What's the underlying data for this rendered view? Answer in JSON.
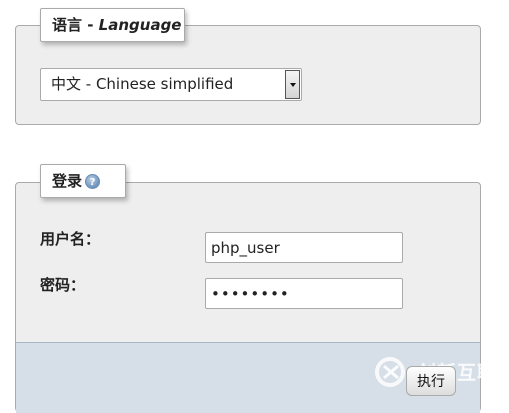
{
  "language": {
    "legend_cn": "语言 - ",
    "legend_en": "Language",
    "selected": "中文 - Chinese simplified"
  },
  "login": {
    "legend": "登录",
    "help_icon": "help-icon",
    "username_label": "用户名：",
    "username_value": "php_user",
    "password_label": "密码：",
    "password_value": "••••••••",
    "submit_label": "执行"
  },
  "watermark": {
    "text": "创新互联"
  },
  "colors": {
    "fieldset_bg": "#eeeeee",
    "footer_bg": "#d6dee8",
    "border": "#aaaaaa"
  }
}
